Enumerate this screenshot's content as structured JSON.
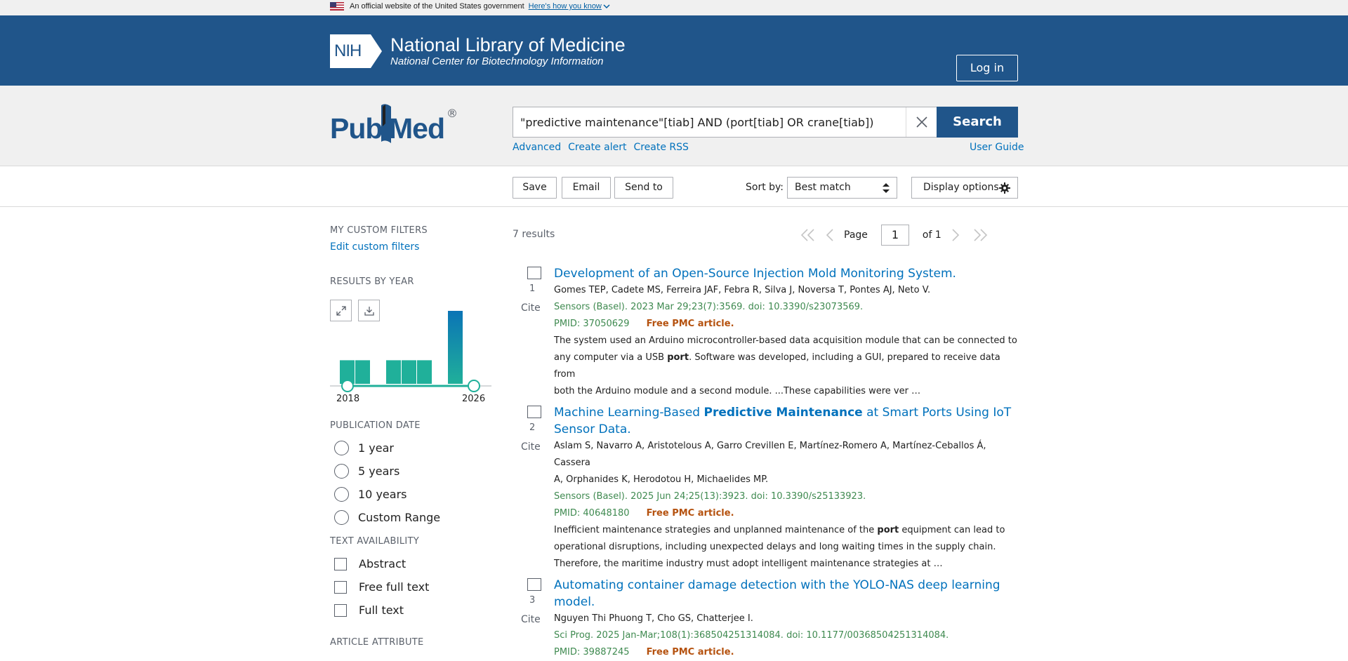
{
  "gov_banner": {
    "text": "An official website of the United States government",
    "link": "Here's how you know"
  },
  "header": {
    "nih": "NIH",
    "title": "National Library of Medicine",
    "subtitle": "National Center for Biotechnology Information",
    "login": "Log in"
  },
  "search": {
    "logo_pub": "Pub",
    "logo_med": "Med",
    "logo_reg": "®",
    "query": "\"predictive maintenance\"[tiab] AND (port[tiab] OR crane[tiab])",
    "button": "Search",
    "links": [
      "Advanced",
      "Create alert",
      "Create RSS"
    ],
    "user_guide": "User Guide"
  },
  "toolbar": {
    "save": "Save",
    "email": "Email",
    "send_to": "Send to",
    "sort_label": "Sort by:",
    "sort_value": "Best match",
    "display_options": "Display options"
  },
  "sidebar": {
    "custom_filters_heading": "MY CUSTOM FILTERS",
    "edit_custom_filters": "Edit custom filters",
    "results_by_year_heading": "RESULTS BY YEAR",
    "year_start": "2018",
    "year_end": "2026",
    "publication_date_heading": "PUBLICATION DATE",
    "publication_date_options": [
      "1 year",
      "5 years",
      "10 years",
      "Custom Range"
    ],
    "text_availability_heading": "TEXT AVAILABILITY",
    "text_availability_options": [
      "Abstract",
      "Free full text",
      "Full text"
    ],
    "article_attribute_heading": "ARTICLE ATTRIBUTE"
  },
  "chart_data": {
    "type": "bar",
    "categories": [
      "2018",
      "2019",
      "2020",
      "2021",
      "2022",
      "2023",
      "2024",
      "2025",
      "2026"
    ],
    "values": [
      1,
      1,
      0,
      1,
      1,
      1,
      0,
      3,
      0
    ],
    "colors": {
      "bar": "#20b09a",
      "highlight": "#0b74b6"
    }
  },
  "results": {
    "count": "7 results",
    "page_label": "Page",
    "page_value": "1",
    "of_label": "of 1",
    "articles": [
      {
        "num": "1",
        "cite": "Cite",
        "title_parts": [
          "Development of an Open-Source Injection Mold Monitoring System."
        ],
        "authors": "Gomes TEP, Cadete MS, Ferreira JAF, Febra R, Silva J, Noversa T, Pontes AJ, Neto V.",
        "citation": "Sensors (Basel). 2023 Mar 29;23(7):3569. doi: 10.3390/s23073569.",
        "pmid": "PMID: 37050629",
        "free": "Free PMC article.",
        "snippet_1": "The system used an Arduino microcontroller-based data acquisition module that can be connected to",
        "snippet_2a": "any computer via a USB ",
        "snippet_2b": "port",
        "snippet_2c": ". Software was developed, including a GUI, prepared to receive data from",
        "snippet_3": "both the Arduino module and a second module. ...These capabilities were ver …"
      },
      {
        "num": "2",
        "cite": "Cite",
        "title_a": "Machine Learning-Based ",
        "title_b": "Predictive Maintenance",
        "title_c": " at Smart Ports Using IoT",
        "title_d": "Sensor Data.",
        "authors_1": "Aslam S, Navarro A, Aristotelous A, Garro Crevillen E, Martínez-Romero A, Martínez-Ceballos Á, Cassera",
        "authors_2": "A, Orphanides K, Herodotou H, Michaelides MP.",
        "citation": "Sensors (Basel). 2025 Jun 24;25(13):3923. doi: 10.3390/s25133923.",
        "pmid": "PMID: 40648180",
        "free": "Free PMC article.",
        "snippet_1a": "Inefficient maintenance strategies and unplanned maintenance of the ",
        "snippet_1b": "port",
        "snippet_1c": " equipment can lead to",
        "snippet_2": "operational disruptions, including unexpected delays and long waiting times in the supply chain.",
        "snippet_3": "Therefore, the maritime industry must adopt intelligent maintenance strategies at …"
      },
      {
        "num": "3",
        "cite": "Cite",
        "title_1": "Automating container damage detection with the YOLO-NAS deep learning",
        "title_2": "model.",
        "authors": "Nguyen Thi Phuong T, Cho GS, Chatterjee I.",
        "citation": "Sci Prog. 2025 Jan-Mar;108(1):368504251314084. doi: 10.1177/00368504251314084.",
        "pmid": "PMID: 39887245",
        "free": "Free PMC article."
      }
    ]
  }
}
